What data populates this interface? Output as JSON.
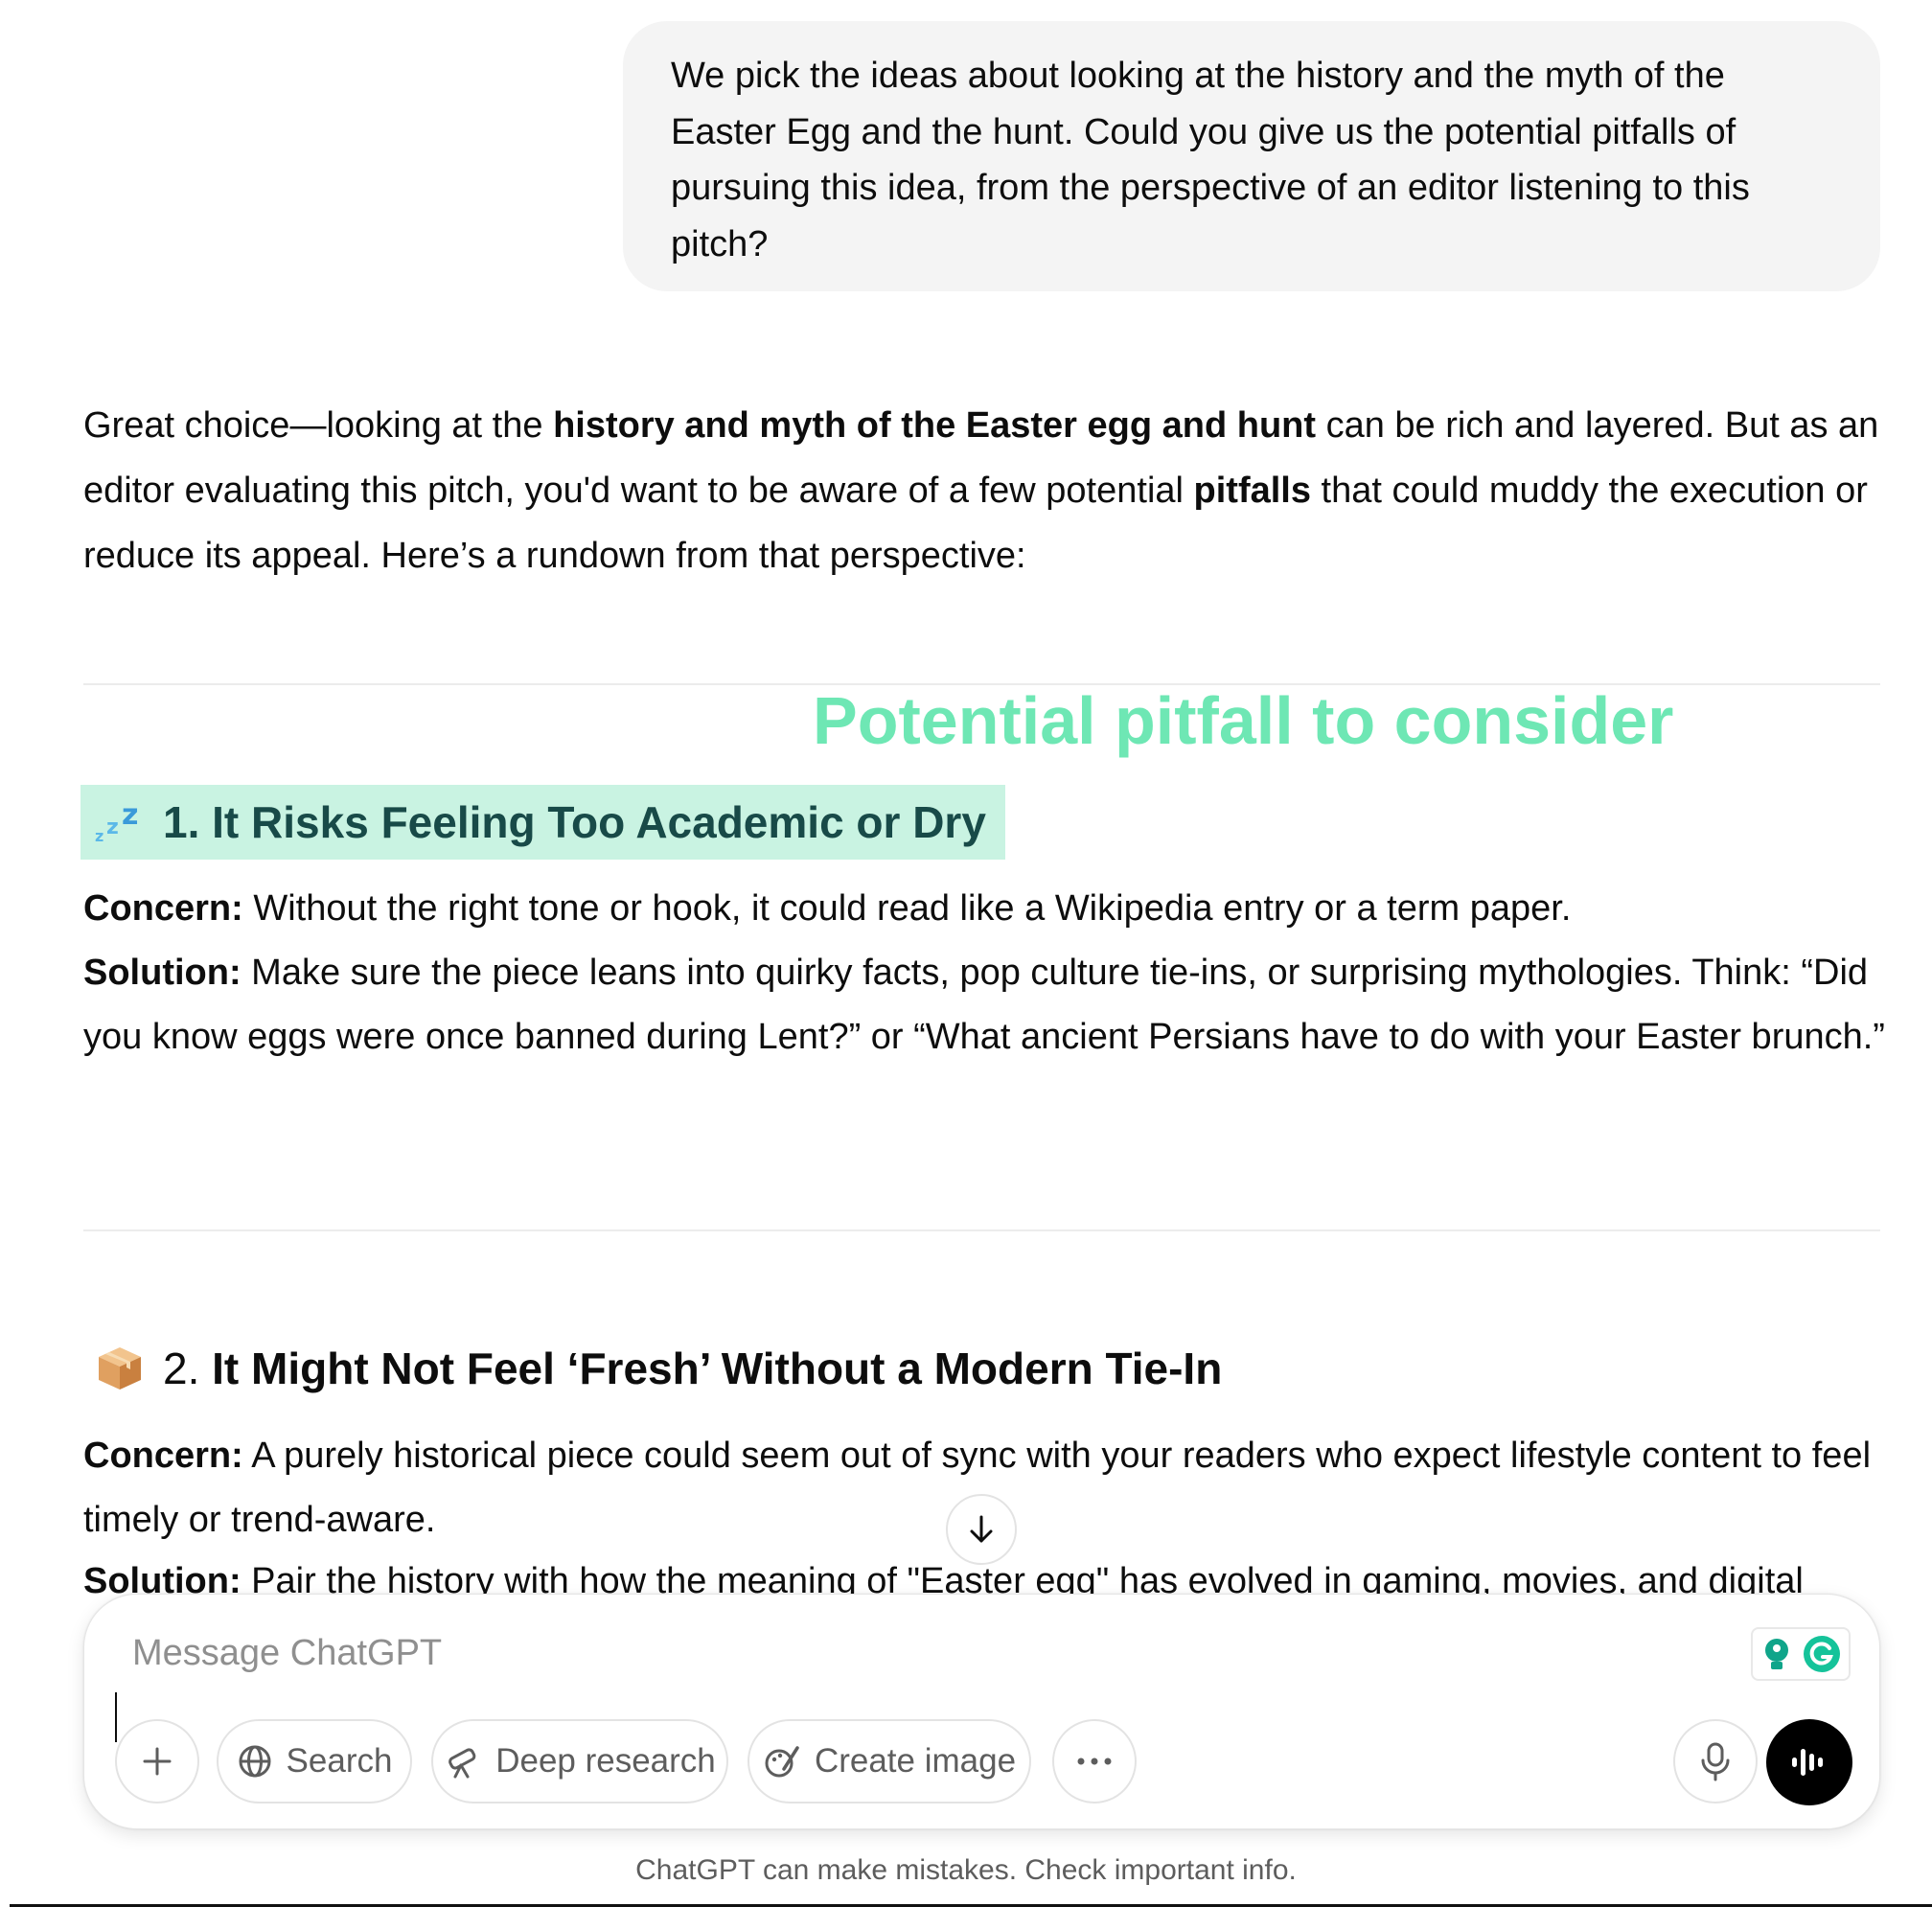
{
  "user_message": "We pick the ideas about looking at the history and the myth of the Easter Egg and the hunt. Could you give us the potential pitfalls of pursuing this idea, from the perspective of an editor listening to this pitch?",
  "response": {
    "intro": {
      "p1": "Great choice—looking at the ",
      "b1": "history and myth of the Easter egg and hunt",
      "p2": " can be rich and layered. But as an editor evaluating this pitch, you'd want to be aware of a few potential ",
      "b2": "pitfalls",
      "p3": " that could muddy the execution or reduce its appeal. Here’s a rundown from that perspective:"
    },
    "annotation": "Potential pitfall to consider",
    "sections": [
      {
        "emoji": "sleeping-zzz-icon",
        "number": "1.",
        "title": "It Risks Feeling Too Academic or Dry",
        "concern_label": "Concern:",
        "concern_text": " Without the right tone or hook, it could read like a Wikipedia entry or a term paper.",
        "solution_label": "Solution:",
        "solution_text": " Make sure the piece leans into quirky facts, pop culture tie-ins, or surprising mythologies. Think: “Did you know eggs were once banned during Lent?” or “What ancient Persians have to do with your Easter brunch.”"
      },
      {
        "emoji": "package-box-icon",
        "number": "2.",
        "title": "It Might Not Feel ‘Fresh’ Without a Modern Tie-In",
        "concern_label": "Concern:",
        "concern_text": " A purely historical piece could seem out of sync with your readers who expect lifestyle content to feel timely or trend-aware.",
        "solution_label": "Solution:",
        "solution_text": " Pair the history with how the meaning of \"Easter egg\" has evolved in gaming, movies, and digital"
      }
    ]
  },
  "composer": {
    "placeholder": "Message ChatGPT",
    "buttons": {
      "search": "Search",
      "deep_research": "Deep research",
      "create_image": "Create image"
    }
  },
  "footer_note": "ChatGPT can make mistakes. Check important info.",
  "colors": {
    "annotation": "#6ee7b4",
    "heading_highlight": "#c9f3e2",
    "bubble": "#f4f4f4"
  }
}
